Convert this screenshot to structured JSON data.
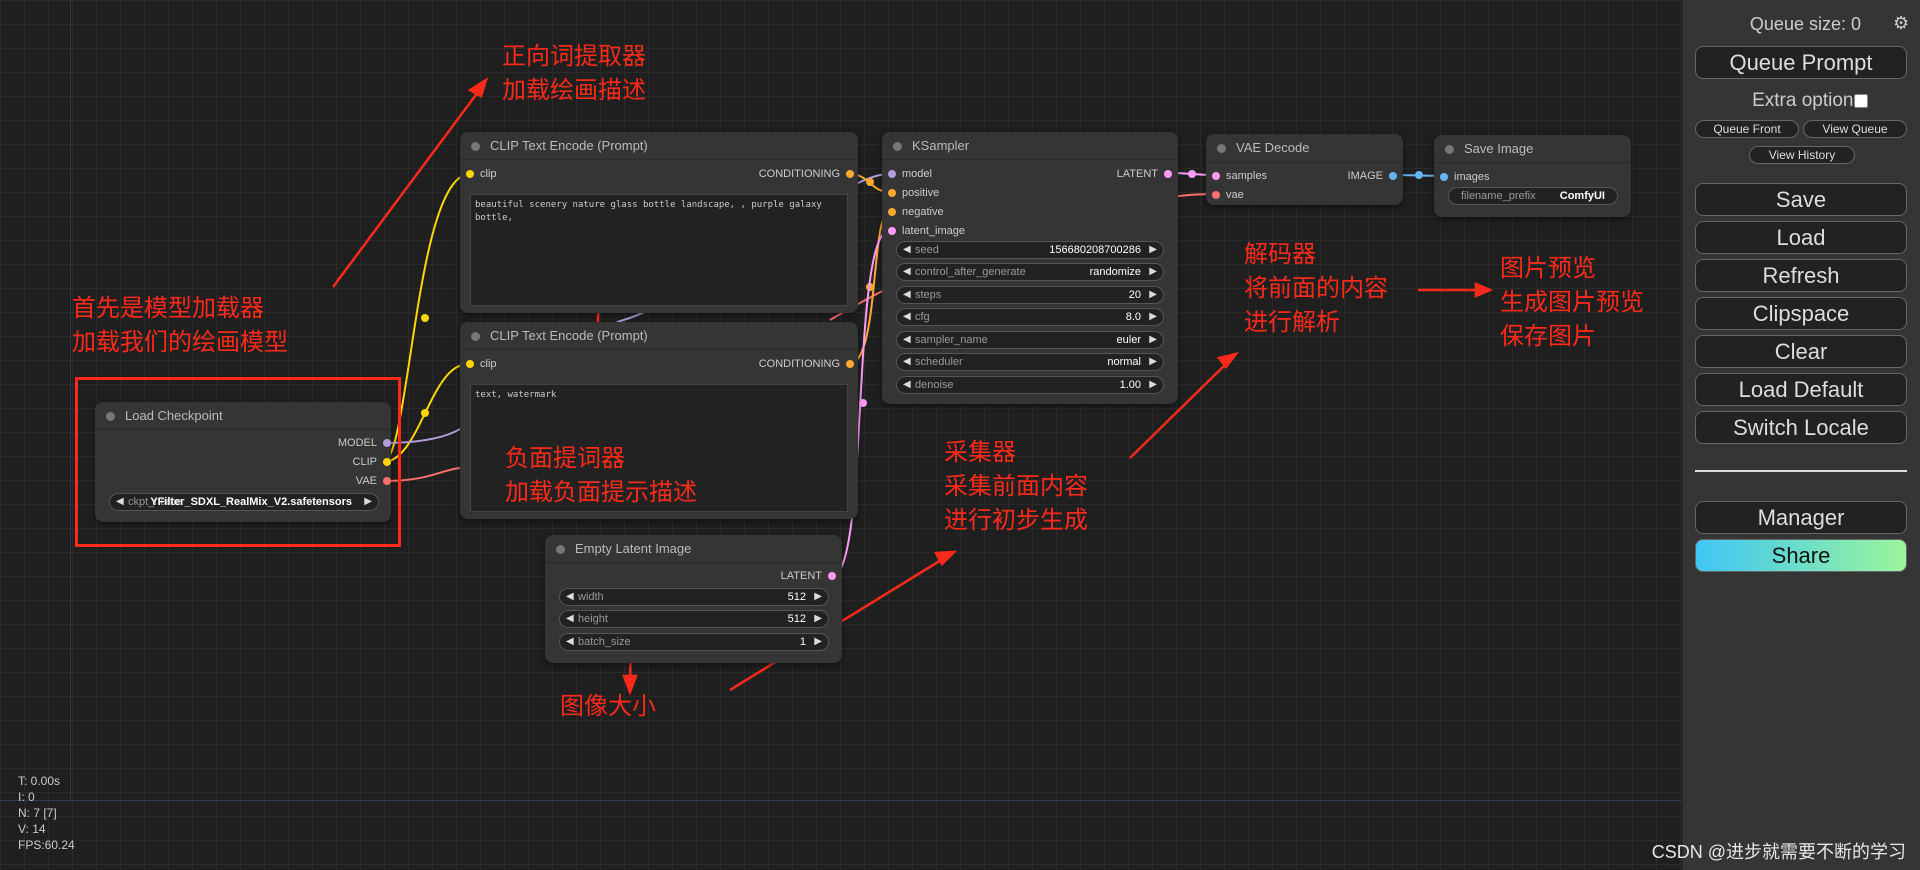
{
  "nodes": {
    "load_checkpoint": {
      "title": "Load Checkpoint",
      "outputs": [
        "MODEL",
        "CLIP",
        "VAE"
      ],
      "ckpt_label": "ckpt_name",
      "ckpt_value": "YFilter_SDXL_RealMix_V2.safetensors"
    },
    "clip_pos": {
      "title": "CLIP Text Encode (Prompt)",
      "input": "clip",
      "output": "CONDITIONING",
      "text": "beautiful scenery nature glass bottle landscape, , purple galaxy bottle,"
    },
    "clip_neg": {
      "title": "CLIP Text Encode (Prompt)",
      "input": "clip",
      "output": "CONDITIONING",
      "text": "text, watermark"
    },
    "empty_latent": {
      "title": "Empty Latent Image",
      "output": "LATENT",
      "widgets": [
        {
          "label": "width",
          "value": "512"
        },
        {
          "label": "height",
          "value": "512"
        },
        {
          "label": "batch_size",
          "value": "1"
        }
      ]
    },
    "ksampler": {
      "title": "KSampler",
      "inputs": [
        "model",
        "positive",
        "negative",
        "latent_image"
      ],
      "output": "LATENT",
      "widgets": [
        {
          "label": "seed",
          "value": "156680208700286"
        },
        {
          "label": "control_after_generate",
          "value": "randomize"
        },
        {
          "label": "steps",
          "value": "20"
        },
        {
          "label": "cfg",
          "value": "8.0"
        },
        {
          "label": "sampler_name",
          "value": "euler"
        },
        {
          "label": "scheduler",
          "value": "normal"
        },
        {
          "label": "denoise",
          "value": "1.00"
        }
      ]
    },
    "vae_decode": {
      "title": "VAE Decode",
      "inputs": [
        "samples",
        "vae"
      ],
      "output": "IMAGE"
    },
    "save_image": {
      "title": "Save Image",
      "input": "images",
      "prefix_label": "filename_prefix",
      "prefix_value": "ComfyUI"
    }
  },
  "annotations": {
    "positive": "正向词提取器\n加载绘画描述",
    "model_loader": "首先是模型加载器\n加载我们的绘画模型",
    "negative": "负面提词器\n加载负面提示描述",
    "image_size": "图像大小",
    "sampler": "采集器\n采集前面内容\n进行初步生成",
    "decoder": "解码器\n将前面的内容\n进行解析",
    "preview": "图片预览\n生成图片预览\n保存图片"
  },
  "stats": {
    "t": "T: 0.00s",
    "i": "I: 0",
    "n": "N: 7 [7]",
    "v": "V: 14",
    "fps": "FPS:60.24"
  },
  "menu": {
    "queue_size": "Queue size: 0",
    "gear_icon": "gear-icon",
    "queue_prompt": "Queue Prompt",
    "extra_options": "Extra options",
    "queue_front": "Queue Front",
    "view_queue": "View Queue",
    "view_history": "View History",
    "save": "Save",
    "load": "Load",
    "refresh": "Refresh",
    "clipspace": "Clipspace",
    "clear": "Clear",
    "load_default": "Load Default",
    "switch_locale": "Switch Locale",
    "manager": "Manager",
    "share": "Share"
  },
  "watermark": "CSDN @进步就需要不断的学习",
  "colors": {
    "annotation_red": "#ff2a1a",
    "clip_wire": "#ffd500",
    "model_wire": "#b39ddb",
    "vae_wire": "#ff6e6e",
    "latent_wire": "#ff9cf9",
    "conditioning_wire": "#ffa931",
    "image_wire": "#64b5f6",
    "share_gradient_start": "#3ec6f5",
    "share_gradient_end": "#9cf59c"
  }
}
